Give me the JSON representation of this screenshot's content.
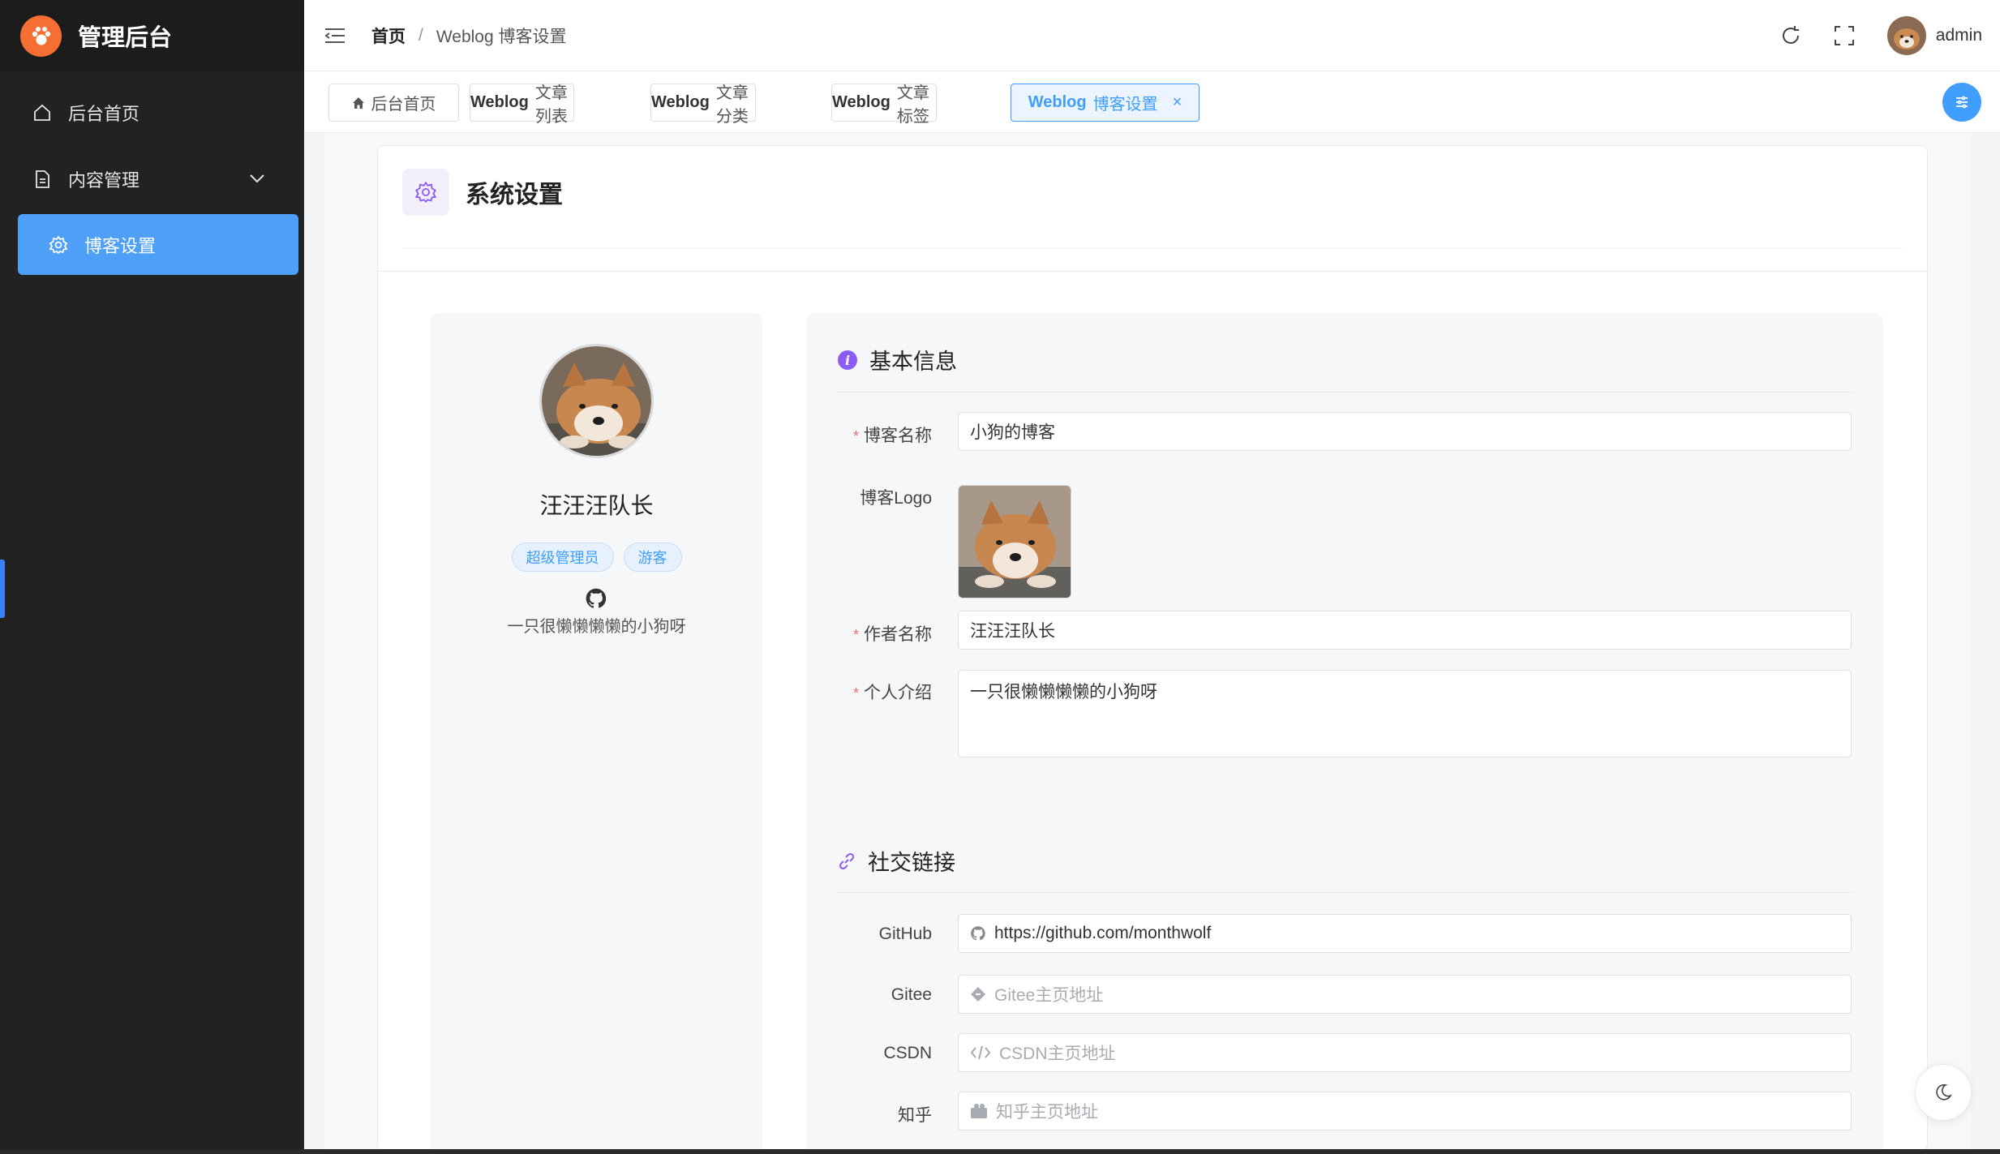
{
  "app": {
    "title": "管理后台",
    "logo_icon": "paw-icon"
  },
  "sidebar": {
    "items": [
      {
        "label": "后台首页",
        "icon": "home-icon"
      },
      {
        "label": "内容管理",
        "icon": "document-icon"
      },
      {
        "label": "博客设置",
        "icon": "gear-icon",
        "active": true
      }
    ]
  },
  "header": {
    "breadcrumb_home": "首页",
    "breadcrumb_sep": "/",
    "breadcrumb_current": "Weblog 博客设置",
    "username": "admin"
  },
  "tabs": [
    {
      "prefix": "",
      "label": "后台首页"
    },
    {
      "prefix": "Weblog",
      "label": "文章列表"
    },
    {
      "prefix": "Weblog",
      "label": "文章分类"
    },
    {
      "prefix": "Weblog",
      "label": "文章标签"
    },
    {
      "prefix": "Weblog",
      "label": "博客设置",
      "active": true
    }
  ],
  "tab_close": "×",
  "card": {
    "title": "系统设置"
  },
  "profile": {
    "name": "汪汪汪队长",
    "tags": [
      "超级管理员",
      "游客"
    ],
    "intro": "一只很懒懒懒懒的小狗呀"
  },
  "basic": {
    "section_title": "基本信息",
    "blog_name_label": "博客名称",
    "blog_name_value": "小狗的博客",
    "logo_label": "博客Logo",
    "author_label": "作者名称",
    "author_value": "汪汪汪队长",
    "intro_label": "个人介绍",
    "intro_value": "一只很懒懒懒懒的小狗呀",
    "required_mark": "*"
  },
  "social": {
    "section_title": "社交链接",
    "github_label": "GitHub",
    "github_value": "https://github.com/monthwolf",
    "gitee_label": "Gitee",
    "gitee_placeholder": "Gitee主页地址",
    "csdn_label": "CSDN",
    "csdn_placeholder": "CSDN主页地址",
    "zhihu_label": "知乎",
    "zhihu_placeholder": "知乎主页地址"
  },
  "colors": {
    "accent": "#409eff",
    "sidebar_bg": "#222222",
    "sidebar_active": "#4e9ff8",
    "brand_logo": "#f56e33",
    "required": "#f56c6c"
  }
}
